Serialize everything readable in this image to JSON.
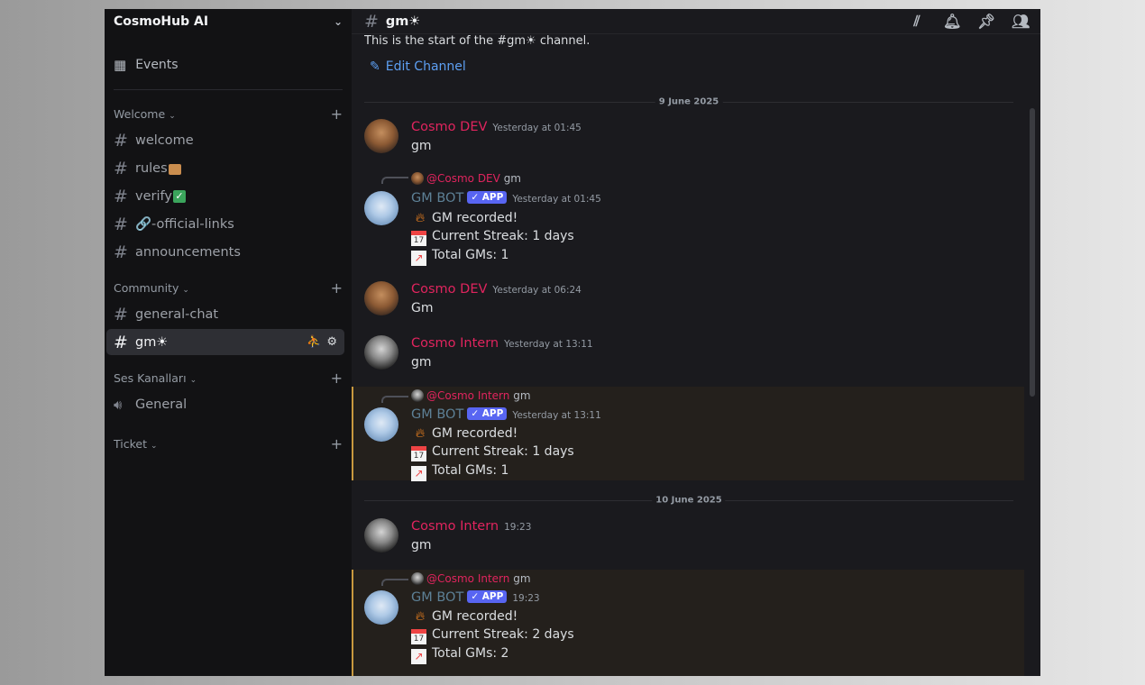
{
  "server": {
    "name": "CosmoHub AI"
  },
  "sidebar": {
    "events_label": "Events",
    "categories": [
      {
        "name": "Welcome",
        "channels": [
          "welcome",
          "rules",
          "verify",
          "🔗-official-links",
          "announcements"
        ]
      },
      {
        "name": "Community",
        "channels": [
          "general-chat",
          "gm☀"
        ]
      },
      {
        "name": "Ses Kanalları",
        "channels": [
          "General"
        ]
      },
      {
        "name": "Ticket",
        "channels": []
      }
    ]
  },
  "channel": {
    "name": "gm☀",
    "start_text": "This is the start of the #gm☀ channel.",
    "edit_label": "Edit Channel"
  },
  "dates": [
    "9 June 2025",
    "10 June 2025"
  ],
  "messages": [
    {
      "author": "Cosmo DEV",
      "time": "Yesterday at 01:45",
      "text": "gm"
    },
    {
      "reply_to": "@Cosmo DEV",
      "reply_text": "gm",
      "author": "GM BOT",
      "badge": "APP",
      "time": "Yesterday at 01:45",
      "lines": [
        "GM recorded!",
        "Current Streak: 1 days",
        "Total GMs: 1"
      ]
    },
    {
      "author": "Cosmo DEV",
      "time": "Yesterday at 06:24",
      "text": "Gm"
    },
    {
      "author": "Cosmo Intern",
      "time": "Yesterday at 13:11",
      "text": "gm"
    },
    {
      "reply_to": "@Cosmo Intern",
      "reply_text": "gm",
      "author": "GM BOT",
      "badge": "APP",
      "time": "Yesterday at 13:11",
      "lines": [
        "GM recorded!",
        "Current Streak: 1 days",
        "Total GMs: 1"
      ]
    },
    {
      "author": "Cosmo Intern",
      "time": "19:23",
      "text": "gm"
    },
    {
      "reply_to": "@Cosmo Intern",
      "reply_text": "gm",
      "author": "GM BOT",
      "badge": "APP",
      "time": "19:23",
      "lines": [
        "GM recorded!",
        "Current Streak: 2 days",
        "Total GMs: 2"
      ]
    }
  ],
  "colors": {
    "accent": "#5865f2",
    "author": "#e0245e",
    "link": "#5d9ff2",
    "highlight_border": "#c9993f"
  }
}
